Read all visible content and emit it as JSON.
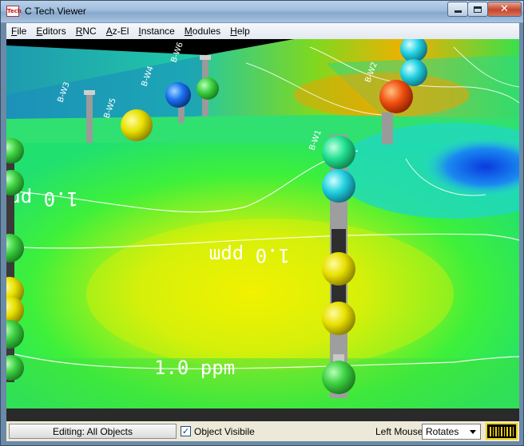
{
  "window": {
    "app_icon_text": "Tech",
    "title": "C Tech Viewer",
    "close_glyph": "✕"
  },
  "menu": [
    "File",
    "Editors",
    "RNC",
    "Az-El",
    "Instance",
    "Modules",
    "Help"
  ],
  "scene": {
    "contour_labels": [
      "1.0 ppm",
      "1.0 ppm",
      "1.0 ppm"
    ],
    "well_labels": [
      "B-W1",
      "B-W2",
      "B-W3",
      "B-W4",
      "B-W5",
      "B-W6"
    ]
  },
  "status": {
    "editing_label": "Editing: All Objects",
    "object_visible_label": "Object Visibile",
    "object_visible_checked": "✓",
    "left_mouse_label": "Left Mouse",
    "left_mouse_value": "Rotates"
  },
  "colors": {
    "accent_yellow": "#f0d000",
    "plume_green": "#3ef03a",
    "plume_yellow": "#e8f000",
    "plume_blue": "#0a4ae8"
  }
}
